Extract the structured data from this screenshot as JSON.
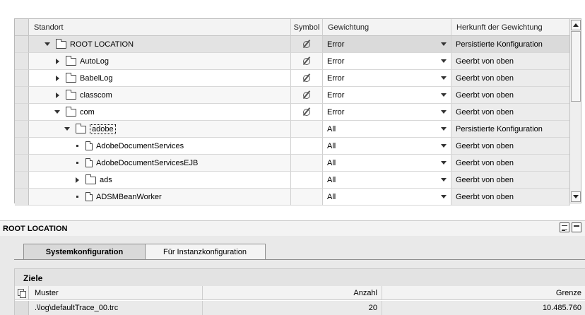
{
  "tree": {
    "columns": {
      "standort": "Standort",
      "symbol": "Symbol",
      "gewichtung": "Gewichtung",
      "herkunft": "Herkunft der Gewichtung"
    },
    "rows": [
      {
        "name": "ROOT LOCATION",
        "icon": "folder-icon",
        "toggle": "expanded",
        "level": 0,
        "symbol": true,
        "gewichtung": "Error",
        "herkunft": "Persistierte Konfiguration",
        "selected": true
      },
      {
        "name": "AutoLog",
        "icon": "folder-icon",
        "toggle": "collapsed",
        "level": 1,
        "symbol": true,
        "gewichtung": "Error",
        "herkunft": "Geerbt von oben"
      },
      {
        "name": "BabelLog",
        "icon": "folder-icon",
        "toggle": "collapsed",
        "level": 1,
        "symbol": true,
        "gewichtung": "Error",
        "herkunft": "Geerbt von oben"
      },
      {
        "name": "classcom",
        "icon": "folder-icon",
        "toggle": "collapsed",
        "level": 1,
        "symbol": true,
        "gewichtung": "Error",
        "herkunft": "Geerbt von oben"
      },
      {
        "name": "com",
        "icon": "folder-icon",
        "toggle": "expanded",
        "level": 1,
        "symbol": true,
        "gewichtung": "Error",
        "herkunft": "Geerbt von oben"
      },
      {
        "name": "adobe",
        "icon": "folder-icon",
        "toggle": "expanded",
        "level": 2,
        "symbol": false,
        "gewichtung": "All",
        "herkunft": "Persistierte Konfiguration",
        "focused": true
      },
      {
        "name": "AdobeDocumentServices",
        "icon": "document-icon",
        "toggle": "leaf",
        "level": 3,
        "symbol": false,
        "gewichtung": "All",
        "herkunft": "Geerbt von oben"
      },
      {
        "name": "AdobeDocumentServicesEJB",
        "icon": "document-icon",
        "toggle": "leaf",
        "level": 3,
        "symbol": false,
        "gewichtung": "All",
        "herkunft": "Geerbt von oben"
      },
      {
        "name": "ads",
        "icon": "folder-icon",
        "toggle": "collapsed",
        "level": 3,
        "symbol": false,
        "gewichtung": "All",
        "herkunft": "Geerbt von oben"
      },
      {
        "name": "ADSMBeanWorker",
        "icon": "document-icon",
        "toggle": "leaf",
        "level": 3,
        "symbol": false,
        "gewichtung": "All",
        "herkunft": "Geerbt von oben"
      }
    ]
  },
  "detail": {
    "title": "ROOT LOCATION",
    "tabs": [
      {
        "label": "Systemkonfiguration",
        "active": true
      },
      {
        "label": "Für Instanzkonfiguration",
        "active": false
      }
    ],
    "ziele": {
      "title": "Ziele",
      "columns": {
        "muster": "Muster",
        "anzahl": "Anzahl",
        "grenze": "Grenze"
      },
      "rows": [
        {
          "muster": ".\\log\\defaultTrace_00.trc",
          "anzahl": "20",
          "grenze": "10.485.760"
        }
      ]
    }
  }
}
